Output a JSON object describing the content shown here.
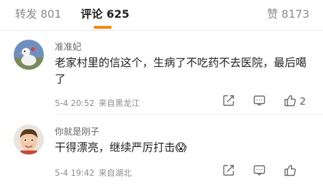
{
  "tabs": {
    "repost": "转发 801",
    "comment": "评论 625",
    "like": "赞 8173"
  },
  "comments": [
    {
      "username": "准准妃",
      "text": "老家村里的信这个，生病了不吃药不去医院，最后噶了",
      "time": "5-4 20:52",
      "source": "来自黑龙江",
      "likes": "2"
    },
    {
      "username": "你就是刚子",
      "text": "干得漂亮，继续严厉打击😱",
      "time": "5-4 19:42",
      "source": "来自湖北",
      "likes": ""
    }
  ],
  "colors": {
    "accent": "#ff8200",
    "muted": "#8c8c8c"
  },
  "icons": [
    "share-icon",
    "reply-icon",
    "like-thumb-icon"
  ]
}
